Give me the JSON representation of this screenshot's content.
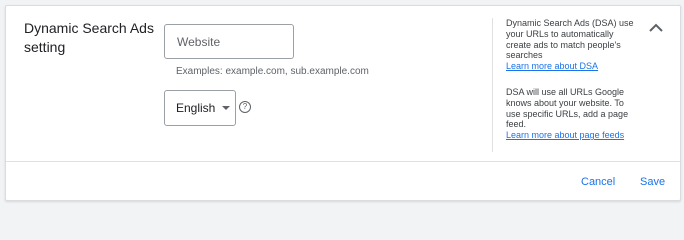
{
  "section": {
    "title": "Dynamic Search Ads setting"
  },
  "website": {
    "placeholder": "Website",
    "value": "",
    "examples": "Examples: example.com, sub.example.com"
  },
  "language": {
    "selected": "English"
  },
  "side_panel": {
    "description": "Dynamic Search Ads (DSA) use your URLs to automatically create ads to match people's searches",
    "link1": "Learn more about DSA",
    "note": "DSA will use all URLs Google knows about your website. To use specific URLs, add a page feed.",
    "link2": "Learn more about page feeds"
  },
  "actions": {
    "cancel_label": "Cancel",
    "save_label": "Save"
  },
  "icons": {
    "help": "help-icon",
    "collapse": "chevron-up-icon",
    "dropdown": "caret-down-icon"
  },
  "colors": {
    "accent": "#1a73e8",
    "text": "#202124",
    "secondary_text": "#5f6368",
    "border": "#dadce0"
  }
}
